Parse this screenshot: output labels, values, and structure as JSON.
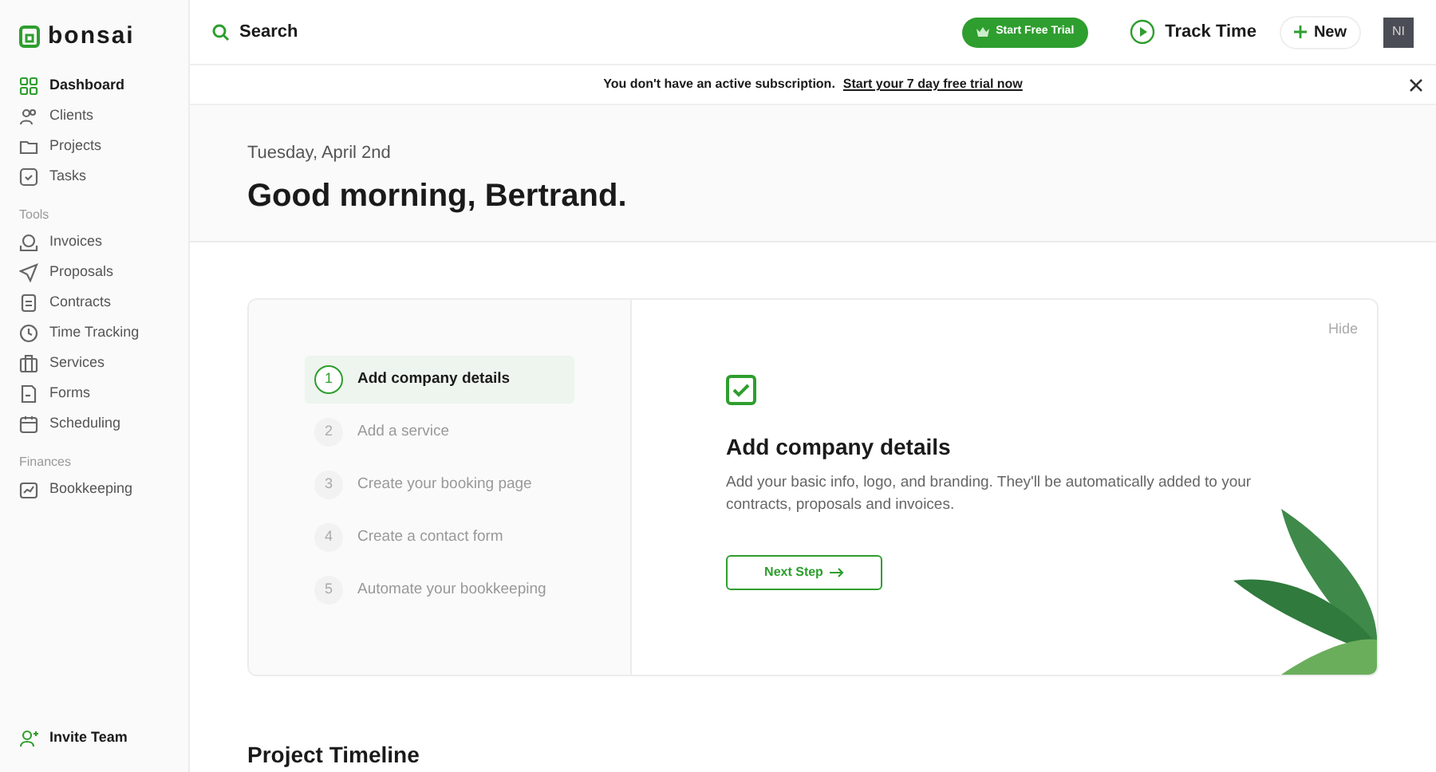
{
  "logo": {
    "text": "bonsai"
  },
  "sidebar": {
    "items": [
      {
        "label": "Dashboard",
        "selected": true
      },
      {
        "label": "Clients",
        "selected": false
      },
      {
        "label": "Projects",
        "selected": false
      },
      {
        "label": "Tasks",
        "selected": false
      }
    ],
    "sections": [
      {
        "title": "Tools",
        "items": [
          {
            "label": "Invoices",
            "selected": false
          },
          {
            "label": "Proposals",
            "selected": false
          },
          {
            "label": "Contracts",
            "selected": false
          },
          {
            "label": "Time Tracking",
            "selected": false
          },
          {
            "label": "Services",
            "selected": false
          },
          {
            "label": "Forms",
            "selected": false
          },
          {
            "label": "Scheduling",
            "selected": false
          }
        ]
      },
      {
        "title": "Finances",
        "items": [
          {
            "label": "Bookkeeping",
            "selected": false
          }
        ]
      }
    ],
    "footer_items": [
      {
        "label": "Invite Team"
      }
    ]
  },
  "topbar": {
    "search": {
      "placeholder": "Search"
    },
    "trial_button": "Start Free Trial",
    "track_time": "Track Time",
    "new_button": "New",
    "avatar": "NI"
  },
  "banner": {
    "text": "You don't have an active subscription.",
    "link": "Start your 7 day free trial now"
  },
  "greeting": {
    "date": "Tuesday, April 2nd",
    "title": "Good morning, Bertrand."
  },
  "onboarding": {
    "steps": [
      {
        "number": "1",
        "label": "Add company details",
        "selected": true
      },
      {
        "number": "2",
        "label": "Add a service",
        "selected": false
      },
      {
        "number": "3",
        "label": "Create your booking page",
        "selected": false
      },
      {
        "number": "4",
        "label": "Create a contact form",
        "selected": false
      },
      {
        "number": "5",
        "label": "Automate your bookkeeping",
        "selected": false
      }
    ],
    "hide": "Hide",
    "title": "Add company details",
    "description": "Add your basic info, logo, and branding. They'll be automatically added to your contracts, proposals and invoices.",
    "button": "Next Step"
  },
  "section_title": "Project Timeline"
}
